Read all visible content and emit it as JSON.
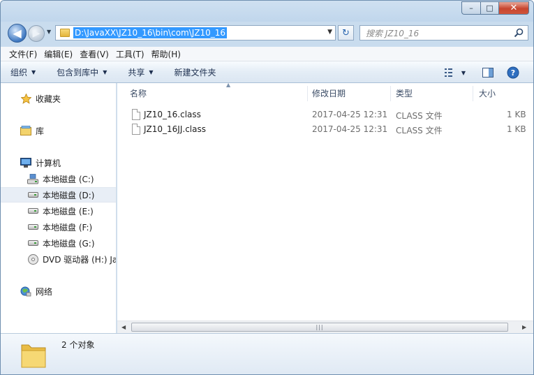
{
  "window": {
    "caption_buttons": {
      "minimize": "–",
      "maximize": "□",
      "close": "✕"
    }
  },
  "nav": {
    "back_glyph": "◀",
    "forward_glyph": "▶",
    "address_path": "D:\\JavaXX\\JZ10_16\\bin\\com\\JZ10_16",
    "refresh_glyph": "↻",
    "search_placeholder": "搜索 JZ10_16"
  },
  "menu": {
    "items": [
      "文件(F)",
      "编辑(E)",
      "查看(V)",
      "工具(T)",
      "帮助(H)"
    ]
  },
  "commands": {
    "organize": "组织",
    "include_in_library": "包含到库中",
    "share": "共享",
    "new_folder": "新建文件夹"
  },
  "navpane": {
    "favorites": "收藏夹",
    "libraries": "库",
    "computer": "计算机",
    "drives": [
      {
        "label": "本地磁盘 (C:)"
      },
      {
        "label": "本地磁盘 (D:)",
        "selected": true
      },
      {
        "label": "本地磁盘 (E:)"
      },
      {
        "label": "本地磁盘 (F:)"
      },
      {
        "label": "本地磁盘 (G:)"
      }
    ],
    "dvd": "DVD 驱动器 (H:) Ja",
    "network": "网络"
  },
  "columns": {
    "name": "名称",
    "date_modified": "修改日期",
    "type": "类型",
    "size": "大小"
  },
  "files": [
    {
      "name": "JZ10_16.class",
      "date": "2017-04-25 12:31",
      "type": "CLASS 文件",
      "size": "1 KB"
    },
    {
      "name": "JZ10_16JJ.class",
      "date": "2017-04-25 12:31",
      "type": "CLASS 文件",
      "size": "1 KB"
    }
  ],
  "status": {
    "count": "2 个对象"
  },
  "colors": {
    "selection": "#3399ff",
    "frame": "#c9dcee"
  }
}
